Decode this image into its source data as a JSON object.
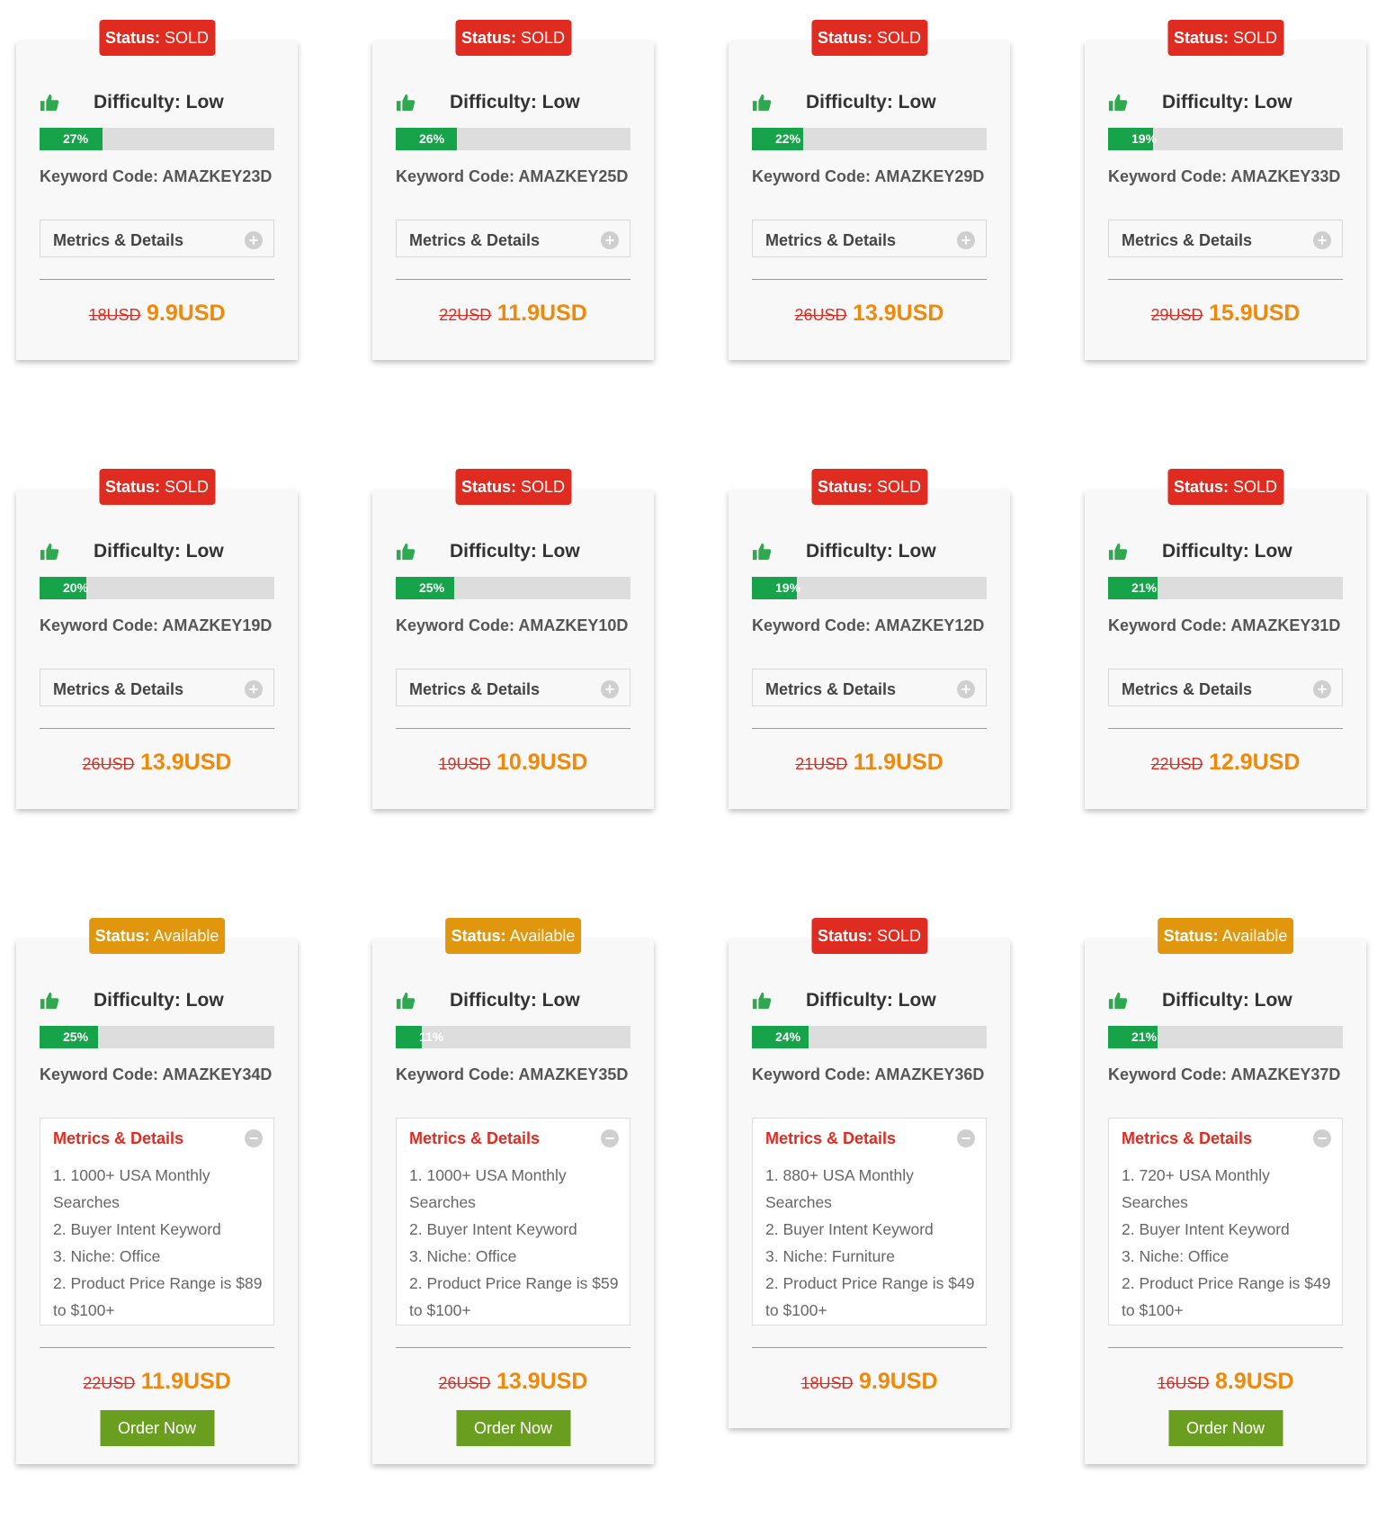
{
  "colors": {
    "sold": "#e02b20",
    "available": "#e0960d",
    "progress_fill": "#16a34a",
    "price_new": "#f0890a",
    "order_button": "#6a9e1f"
  },
  "labels": {
    "status_prefix": "Status:",
    "difficulty": "Difficulty: Low",
    "code_prefix": "Keyword Code:",
    "metrics": "Metrics & Details",
    "order": "Order Now"
  },
  "cards": [
    {
      "status": "SOLD",
      "progress": 27,
      "progress_text": "27%",
      "code": "AMAZKEY23D",
      "old_price": "18USD",
      "new_price": "9.9USD"
    },
    {
      "status": "SOLD",
      "progress": 26,
      "progress_text": "26%",
      "code": "AMAZKEY25D",
      "old_price": "22USD",
      "new_price": "11.9USD"
    },
    {
      "status": "SOLD",
      "progress": 22,
      "progress_text": "22%",
      "code": "AMAZKEY29D",
      "old_price": "26USD",
      "new_price": "13.9USD"
    },
    {
      "status": "SOLD",
      "progress": 19,
      "progress_text": "19%",
      "code": "AMAZKEY33D",
      "old_price": "29USD",
      "new_price": "15.9USD"
    },
    {
      "status": "SOLD",
      "progress": 20,
      "progress_text": "20%",
      "code": "AMAZKEY19D",
      "old_price": "26USD",
      "new_price": "13.9USD"
    },
    {
      "status": "SOLD",
      "progress": 25,
      "progress_text": "25%",
      "code": "AMAZKEY10D",
      "old_price": "19USD",
      "new_price": "10.9USD"
    },
    {
      "status": "SOLD",
      "progress": 19,
      "progress_text": "19%",
      "code": "AMAZKEY12D",
      "old_price": "21USD",
      "new_price": "11.9USD"
    },
    {
      "status": "SOLD",
      "progress": 21,
      "progress_text": "21%",
      "code": "AMAZKEY31D",
      "old_price": "22USD",
      "new_price": "12.9USD"
    },
    {
      "status": "Available",
      "progress": 25,
      "progress_text": "25%",
      "code": "AMAZKEY34D",
      "old_price": "22USD",
      "new_price": "11.9USD",
      "order": true,
      "details": [
        "1. 1000+ USA Monthly",
        "Searches",
        "2. Buyer Intent Keyword",
        "3. Niche: Office",
        "2. Product Price Range is $89",
        "to $100+"
      ]
    },
    {
      "status": "Available",
      "progress": 11,
      "progress_text": "11%",
      "code": "AMAZKEY35D",
      "old_price": "26USD",
      "new_price": "13.9USD",
      "order": true,
      "details": [
        "1. 1000+ USA Monthly",
        "Searches",
        "2. Buyer Intent Keyword",
        "3. Niche: Office",
        "2. Product Price Range is $59",
        "to $100+"
      ]
    },
    {
      "status": "SOLD",
      "progress": 24,
      "progress_text": "24%",
      "code": "AMAZKEY36D",
      "old_price": "18USD",
      "new_price": "9.9USD",
      "order": false,
      "details": [
        "1. 880+ USA Monthly",
        "Searches",
        "2. Buyer Intent Keyword",
        "3. Niche: Furniture",
        "2. Product Price Range is $49",
        "to $100+"
      ]
    },
    {
      "status": "Available",
      "progress": 21,
      "progress_text": "21%",
      "code": "AMAZKEY37D",
      "old_price": "16USD",
      "new_price": "8.9USD",
      "order": true,
      "details": [
        "1. 720+ USA Monthly",
        "Searches",
        "2. Buyer Intent Keyword",
        "3. Niche: Office",
        "2. Product Price Range is $49",
        "to $100+"
      ]
    }
  ]
}
